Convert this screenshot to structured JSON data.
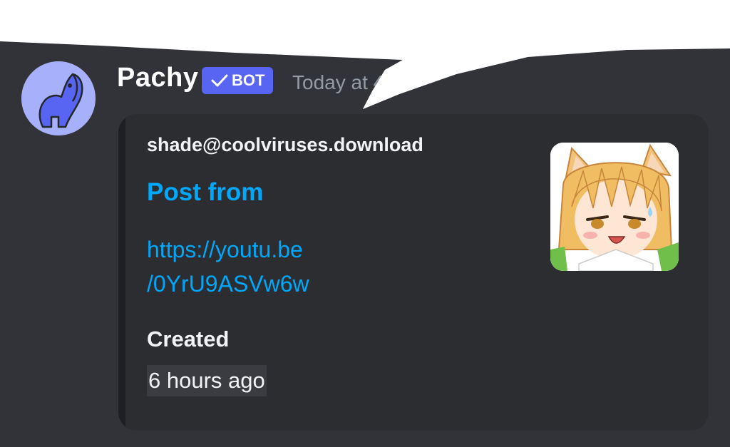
{
  "message": {
    "username": "Pachy",
    "bot_badge": "BOT",
    "timestamp": "Today at 4",
    "avatar_icon": "elephant-icon"
  },
  "embed": {
    "author": "shade@coolviruses.download",
    "title": "Post from",
    "link_lines": [
      "https://youtu.be",
      "/0YrU9ASVw6w"
    ],
    "fields": [
      {
        "name": "Created",
        "value": "6 hours ago"
      }
    ],
    "thumbnail": "anime-fox-girl-image"
  },
  "colors": {
    "background": "#313338",
    "embed_bg": "#2b2d31",
    "link": "#00a8fc",
    "bot_badge": "#5865f2",
    "avatar_bg": "#a7b1fb",
    "timestamp": "#949ba4"
  }
}
